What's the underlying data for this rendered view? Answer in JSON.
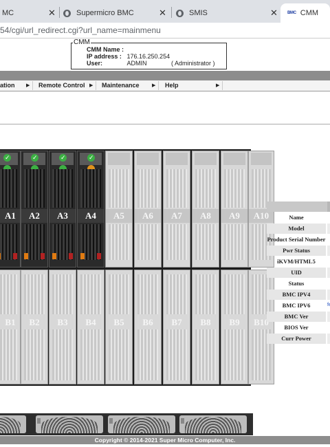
{
  "browser": {
    "tabs": [
      {
        "title": "MC",
        "favicon": "globe-icon"
      },
      {
        "title": "Supermicro BMC",
        "favicon": "globe-icon"
      },
      {
        "title": "SMIS",
        "favicon": "globe-icon"
      },
      {
        "title": "CMM",
        "favicon": "bmc-icon",
        "active": true
      }
    ],
    "url": "54/cgi/url_redirect.cgi?url_name=mainmenu",
    "favicon_text": "BMC"
  },
  "cmm_box": {
    "legend": "CMM",
    "name_label": "CMM Name :",
    "name_value": "",
    "ip_label": "IP address :",
    "ip_value": "176.16.250.254",
    "user_label": "User:",
    "user_value": "ADMIN",
    "role_value": "( Administrator )"
  },
  "menu": [
    {
      "label": "ation"
    },
    {
      "label": "Remote Control"
    },
    {
      "label": "Maintenance"
    },
    {
      "label": "Help"
    }
  ],
  "blades_a": [
    {
      "label": "A1",
      "installed": true
    },
    {
      "label": "A2",
      "installed": true
    },
    {
      "label": "A3",
      "installed": true
    },
    {
      "label": "A4",
      "installed": true
    },
    {
      "label": "A5",
      "installed": false
    },
    {
      "label": "A6",
      "installed": false
    },
    {
      "label": "A7",
      "installed": false
    },
    {
      "label": "A8",
      "installed": false
    },
    {
      "label": "A9",
      "installed": false
    },
    {
      "label": "A10",
      "installed": false
    }
  ],
  "blades_b": [
    {
      "label": "B1",
      "installed": false
    },
    {
      "label": "B2",
      "installed": false
    },
    {
      "label": "B3",
      "installed": false
    },
    {
      "label": "B4",
      "installed": false
    },
    {
      "label": "B5",
      "installed": false
    },
    {
      "label": "B6",
      "installed": false
    },
    {
      "label": "B7",
      "installed": false
    },
    {
      "label": "B8",
      "installed": false
    },
    {
      "label": "B9",
      "installed": false
    },
    {
      "label": "B10",
      "installed": false
    }
  ],
  "properties": [
    "Name",
    "Model",
    "Product Serial Number",
    "Pwr Status",
    "iKVM/HTML5",
    "UID",
    "Status",
    "BMC IPV4",
    "BMC IPV6",
    "BMC Ver",
    "BIOS Ver",
    "Curr Power"
  ],
  "footer": "Copyright © 2014-2021 Super Micro Computer, Inc.",
  "colors": {
    "menu_band": "#8d8d8d",
    "chassis_bg": "#1b1b1b",
    "led_green": "#3cb043",
    "led_blue": "#4050d0",
    "led_orange": "#e0921c",
    "link_blue": "#1f4dbf"
  }
}
